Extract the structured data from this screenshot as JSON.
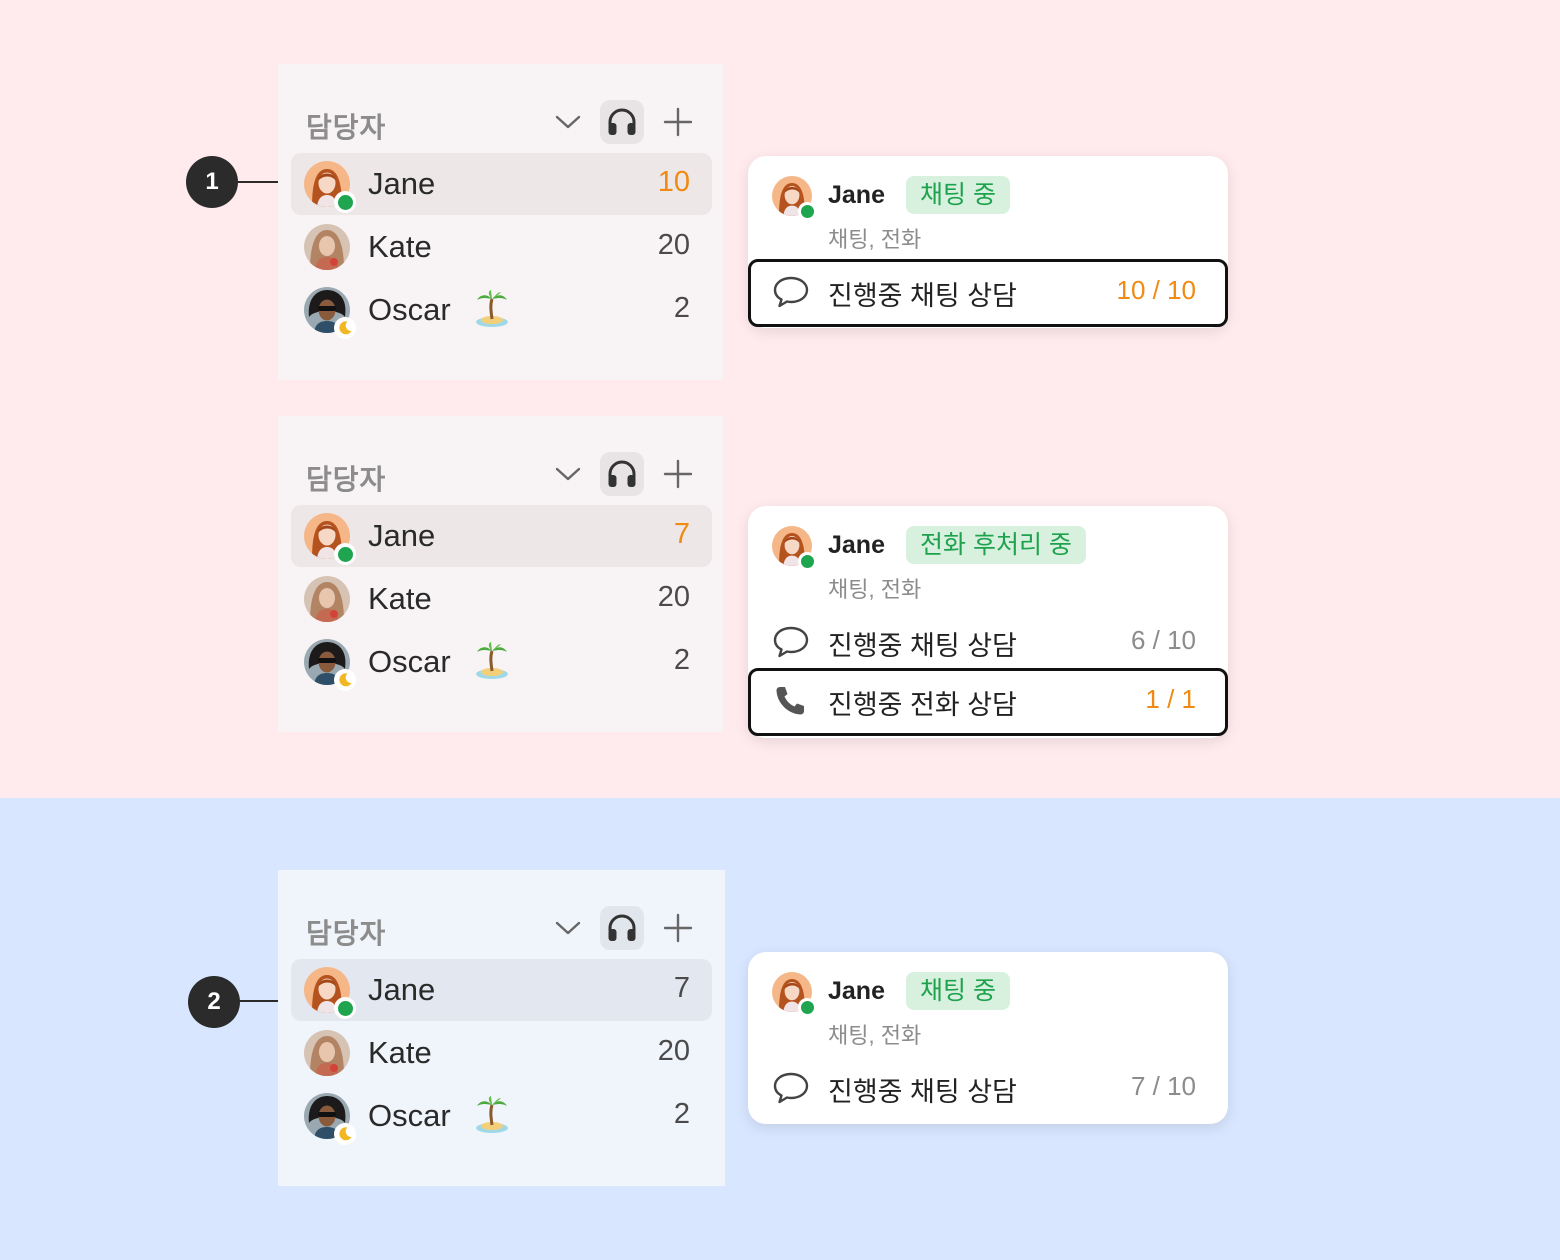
{
  "panel_title": "담당자",
  "icons": {
    "collapse": "chevron-down-icon",
    "headset": "headset-icon",
    "add": "plus-icon",
    "vacation": "palm-island-emoji",
    "away": "moon-icon",
    "online": "green-dot",
    "chat": "chat-bubble-icon",
    "phone": "phone-icon"
  },
  "colors": {
    "top_background": "#ffebee",
    "bottom_background": "#d8e6ff",
    "count_highlight": "#f08a12",
    "online_status": "#1fa550",
    "badge_background": "#d8f1df",
    "badge_text": "#1ea24d"
  },
  "markers": [
    "1",
    "2"
  ],
  "panels": [
    {
      "rows": [
        {
          "name": "Jane",
          "count": "10",
          "highlight": true,
          "selected": true,
          "status": "online"
        },
        {
          "name": "Kate",
          "count": "20",
          "highlight": false,
          "selected": false,
          "status": "none"
        },
        {
          "name": "Oscar",
          "count": "2",
          "highlight": false,
          "selected": false,
          "status": "away",
          "vacation": true
        }
      ]
    },
    {
      "rows": [
        {
          "name": "Jane",
          "count": "7",
          "highlight": true,
          "selected": true,
          "status": "online"
        },
        {
          "name": "Kate",
          "count": "20",
          "highlight": false,
          "selected": false,
          "status": "none"
        },
        {
          "name": "Oscar",
          "count": "2",
          "highlight": false,
          "selected": false,
          "status": "away",
          "vacation": true
        }
      ]
    },
    {
      "rows": [
        {
          "name": "Jane",
          "count": "7",
          "highlight": false,
          "selected": true,
          "status": "online"
        },
        {
          "name": "Kate",
          "count": "20",
          "highlight": false,
          "selected": false,
          "status": "none"
        },
        {
          "name": "Oscar",
          "count": "2",
          "highlight": false,
          "selected": false,
          "status": "away",
          "vacation": true
        }
      ]
    }
  ],
  "cards": [
    {
      "name": "Jane",
      "badge": "채팅 중",
      "channels": "채팅, 전화",
      "items": [
        {
          "label": "진행중 채팅 상담",
          "count": "10 / 10",
          "highlight": true,
          "icon": "chat"
        }
      ]
    },
    {
      "name": "Jane",
      "badge": "전화 후처리 중",
      "channels": "채팅, 전화",
      "items": [
        {
          "label": "진행중 채팅 상담",
          "count": "6 / 10",
          "highlight": false,
          "icon": "chat"
        },
        {
          "label": "진행중 전화 상담",
          "count": "1 / 1",
          "highlight": true,
          "icon": "phone"
        }
      ]
    },
    {
      "name": "Jane",
      "badge": "채팅 중",
      "channels": "채팅, 전화",
      "items": [
        {
          "label": "진행중 채팅 상담",
          "count": "7 / 10",
          "highlight": false,
          "icon": "chat"
        }
      ]
    }
  ]
}
